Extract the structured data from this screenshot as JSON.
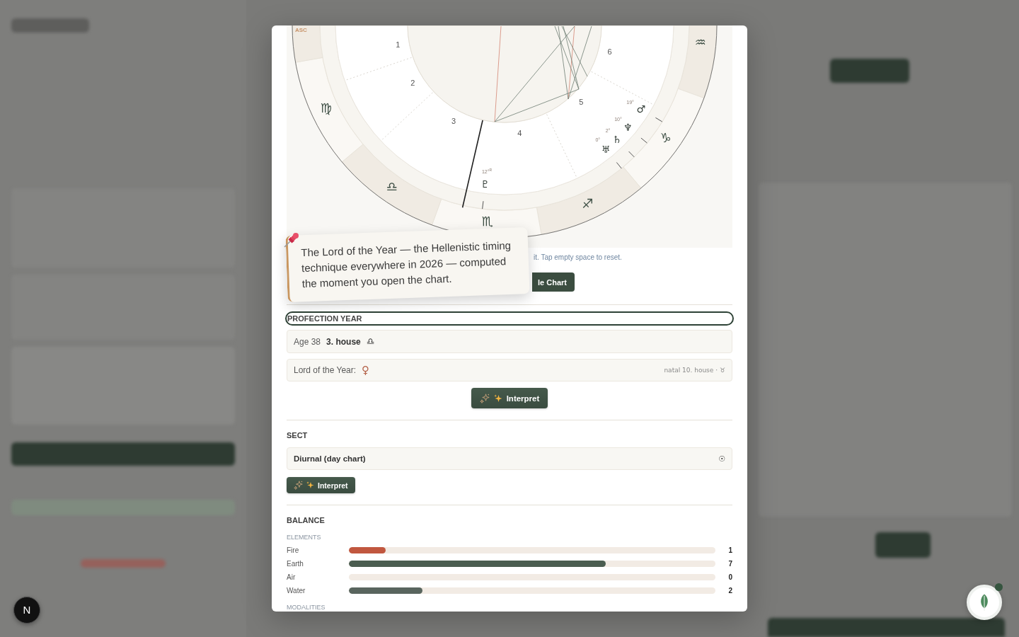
{
  "chart": {
    "asc_label": "ASC",
    "signs": [
      "♒",
      "♑",
      "♐",
      "♏",
      "♎",
      "♍"
    ],
    "houses": [
      "1",
      "2",
      "3",
      "4",
      "5",
      "6"
    ],
    "planets": [
      {
        "glyph": "♂",
        "degree": "19°"
      },
      {
        "glyph": "♆",
        "degree": "10°"
      },
      {
        "glyph": "♄",
        "degree": "2°"
      },
      {
        "glyph": "♅",
        "degree": "0°"
      },
      {
        "glyph": "♇",
        "degree": "12°$^{R}$"
      }
    ],
    "hint": "it. Tap empty space to reset.",
    "button": "le Chart"
  },
  "note": {
    "text": "The Lord of the Year — the Hellenistic timing technique everywhere in 2026 — computed the moment you open the chart."
  },
  "profection": {
    "title": "PROFECTION YEAR",
    "focused": true,
    "age": "Age 38",
    "house": "3. house",
    "house_sign": "♎",
    "lord_label": "Lord of the Year:",
    "lord_planet": "♀",
    "lord_detail": "natal 10. house · ♉",
    "button": "Interpret"
  },
  "sect": {
    "title": "SECT",
    "value": "Diurnal (day chart)",
    "symbol": "☉",
    "button": "Interpret"
  },
  "balance": {
    "title": "BALANCE",
    "elements": {
      "title": "ELEMENTS",
      "items": [
        {
          "name": "Fire",
          "count": "1",
          "level": 0.1,
          "color": "#c1573f"
        },
        {
          "name": "Earth",
          "count": "7",
          "level": 0.7,
          "color": "#4b5d50"
        },
        {
          "name": "Air",
          "count": "0",
          "level": 0
        },
        {
          "name": "Water",
          "count": "2",
          "level": 0.2,
          "color": "#59655e"
        }
      ]
    },
    "modalities": {
      "title": "MODALITIES"
    }
  },
  "dev_badge": {
    "label": "N"
  }
}
